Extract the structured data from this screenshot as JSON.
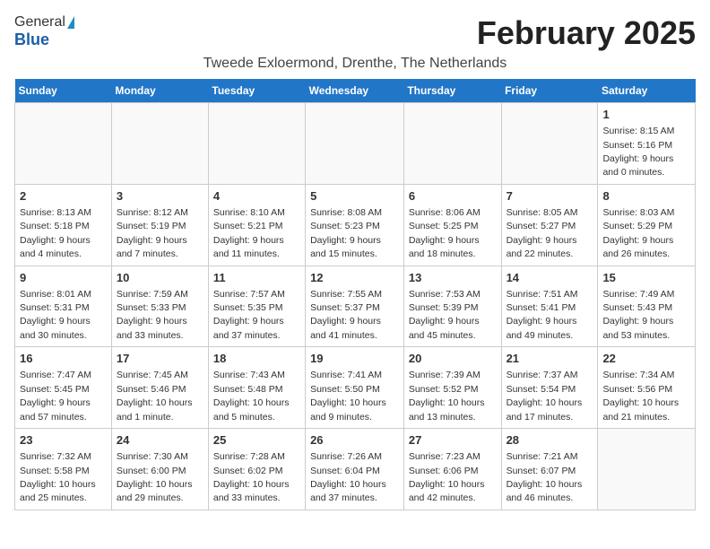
{
  "logo": {
    "general": "General",
    "blue": "Blue"
  },
  "title": "February 2025",
  "location": "Tweede Exloermond, Drenthe, The Netherlands",
  "weekdays": [
    "Sunday",
    "Monday",
    "Tuesday",
    "Wednesday",
    "Thursday",
    "Friday",
    "Saturday"
  ],
  "weeks": [
    [
      {
        "day": "",
        "info": ""
      },
      {
        "day": "",
        "info": ""
      },
      {
        "day": "",
        "info": ""
      },
      {
        "day": "",
        "info": ""
      },
      {
        "day": "",
        "info": ""
      },
      {
        "day": "",
        "info": ""
      },
      {
        "day": "1",
        "info": "Sunrise: 8:15 AM\nSunset: 5:16 PM\nDaylight: 9 hours and 0 minutes."
      }
    ],
    [
      {
        "day": "2",
        "info": "Sunrise: 8:13 AM\nSunset: 5:18 PM\nDaylight: 9 hours and 4 minutes."
      },
      {
        "day": "3",
        "info": "Sunrise: 8:12 AM\nSunset: 5:19 PM\nDaylight: 9 hours and 7 minutes."
      },
      {
        "day": "4",
        "info": "Sunrise: 8:10 AM\nSunset: 5:21 PM\nDaylight: 9 hours and 11 minutes."
      },
      {
        "day": "5",
        "info": "Sunrise: 8:08 AM\nSunset: 5:23 PM\nDaylight: 9 hours and 15 minutes."
      },
      {
        "day": "6",
        "info": "Sunrise: 8:06 AM\nSunset: 5:25 PM\nDaylight: 9 hours and 18 minutes."
      },
      {
        "day": "7",
        "info": "Sunrise: 8:05 AM\nSunset: 5:27 PM\nDaylight: 9 hours and 22 minutes."
      },
      {
        "day": "8",
        "info": "Sunrise: 8:03 AM\nSunset: 5:29 PM\nDaylight: 9 hours and 26 minutes."
      }
    ],
    [
      {
        "day": "9",
        "info": "Sunrise: 8:01 AM\nSunset: 5:31 PM\nDaylight: 9 hours and 30 minutes."
      },
      {
        "day": "10",
        "info": "Sunrise: 7:59 AM\nSunset: 5:33 PM\nDaylight: 9 hours and 33 minutes."
      },
      {
        "day": "11",
        "info": "Sunrise: 7:57 AM\nSunset: 5:35 PM\nDaylight: 9 hours and 37 minutes."
      },
      {
        "day": "12",
        "info": "Sunrise: 7:55 AM\nSunset: 5:37 PM\nDaylight: 9 hours and 41 minutes."
      },
      {
        "day": "13",
        "info": "Sunrise: 7:53 AM\nSunset: 5:39 PM\nDaylight: 9 hours and 45 minutes."
      },
      {
        "day": "14",
        "info": "Sunrise: 7:51 AM\nSunset: 5:41 PM\nDaylight: 9 hours and 49 minutes."
      },
      {
        "day": "15",
        "info": "Sunrise: 7:49 AM\nSunset: 5:43 PM\nDaylight: 9 hours and 53 minutes."
      }
    ],
    [
      {
        "day": "16",
        "info": "Sunrise: 7:47 AM\nSunset: 5:45 PM\nDaylight: 9 hours and 57 minutes."
      },
      {
        "day": "17",
        "info": "Sunrise: 7:45 AM\nSunset: 5:46 PM\nDaylight: 10 hours and 1 minute."
      },
      {
        "day": "18",
        "info": "Sunrise: 7:43 AM\nSunset: 5:48 PM\nDaylight: 10 hours and 5 minutes."
      },
      {
        "day": "19",
        "info": "Sunrise: 7:41 AM\nSunset: 5:50 PM\nDaylight: 10 hours and 9 minutes."
      },
      {
        "day": "20",
        "info": "Sunrise: 7:39 AM\nSunset: 5:52 PM\nDaylight: 10 hours and 13 minutes."
      },
      {
        "day": "21",
        "info": "Sunrise: 7:37 AM\nSunset: 5:54 PM\nDaylight: 10 hours and 17 minutes."
      },
      {
        "day": "22",
        "info": "Sunrise: 7:34 AM\nSunset: 5:56 PM\nDaylight: 10 hours and 21 minutes."
      }
    ],
    [
      {
        "day": "23",
        "info": "Sunrise: 7:32 AM\nSunset: 5:58 PM\nDaylight: 10 hours and 25 minutes."
      },
      {
        "day": "24",
        "info": "Sunrise: 7:30 AM\nSunset: 6:00 PM\nDaylight: 10 hours and 29 minutes."
      },
      {
        "day": "25",
        "info": "Sunrise: 7:28 AM\nSunset: 6:02 PM\nDaylight: 10 hours and 33 minutes."
      },
      {
        "day": "26",
        "info": "Sunrise: 7:26 AM\nSunset: 6:04 PM\nDaylight: 10 hours and 37 minutes."
      },
      {
        "day": "27",
        "info": "Sunrise: 7:23 AM\nSunset: 6:06 PM\nDaylight: 10 hours and 42 minutes."
      },
      {
        "day": "28",
        "info": "Sunrise: 7:21 AM\nSunset: 6:07 PM\nDaylight: 10 hours and 46 minutes."
      },
      {
        "day": "",
        "info": ""
      }
    ]
  ]
}
